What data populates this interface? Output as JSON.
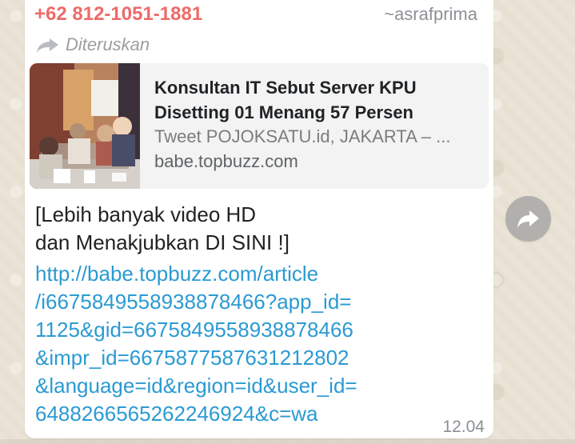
{
  "chat": {
    "sender_phone": "+62 812-1051-1881",
    "sender_name": "~asrafprima",
    "forwarded_label": "Diteruskan",
    "preview": {
      "title": "Konsultan IT Sebut Server KPU Disetting 01 Menang 57 Persen",
      "description": "Tweet POJOKSATU.id, JAKARTA – ...",
      "domain": "babe.topbuzz.com"
    },
    "message_lines": [
      "[Lebih banyak video HD",
      "dan Menakjubkan DI SINI !]"
    ],
    "link_lines": [
      "http://babe.topbuzz.com/article",
      "/i6675849558938878466?app_id=",
      "1125&gid=6675849558938878466",
      "&impr_id=6675877587631212802",
      "&language=id&region=id&user_id=",
      "6488266565262246924&c=wa"
    ],
    "time": "12.04"
  },
  "icons": {
    "forwarded": "forward-arrow-icon",
    "share": "share-arrow-icon"
  },
  "colors": {
    "sender_phone": "#ef6a69",
    "link": "#2b9ad2",
    "muted_text": "#8d9094",
    "bubble": "#ffffff",
    "chat_background": "#e8e1d3",
    "share_button": "#a2a2a2"
  }
}
